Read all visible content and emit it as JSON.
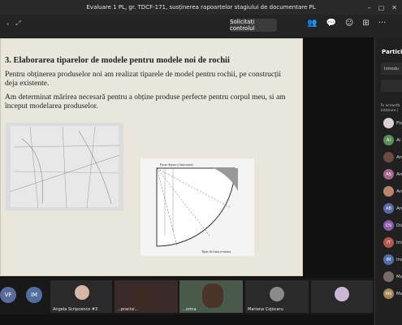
{
  "title": "Evaluare 1 PL, gr. TDCF-171, susținerea rapoartelor stagiului de documentare PL",
  "toolbar": {
    "request_control": "Solicitați controlul"
  },
  "slide": {
    "heading": "3. Elaborarea tiparelor de modele pentru modele noi de rochii",
    "p1": "Pentru obținerea produselor noi am realizat tiparele de model pentru rochii, pe construcții deja existente.",
    "p2": "Am determinat mărirea necesară pentru a obține produse perfecte pentru corpul meu, si am început modelarea produselor.",
    "figure_top_label": "Fusta dejuno (clasicaosa)",
    "figure_bottom_label": "Tipar de fusta evaziata"
  },
  "gallery": {
    "avatar1": "VF",
    "avatar2": "IM",
    "tile1_name": "Angela Scripcenco #3",
    "tile2_name": "...pracivi...",
    "tile3_name": "...orina",
    "tile4_name": "Mariana Cojocaru"
  },
  "panel": {
    "title": "Particip",
    "field": "Introdu",
    "section": "În această\nîntâlnire (",
    "participants": [
      {
        "initials": "",
        "name": "Flo",
        "color": "#d9cfd5"
      },
      {
        "initials": "AI",
        "name": "Ai",
        "color": "#5a8f5a"
      },
      {
        "initials": "",
        "name": "An",
        "color": "#6b4a3f"
      },
      {
        "initials": "AS",
        "name": "An",
        "color": "#a5648a"
      },
      {
        "initials": "",
        "name": "An",
        "color": "#b8866d"
      },
      {
        "initials": "AB",
        "name": "An",
        "color": "#5a6aa8"
      },
      {
        "initials": "DS",
        "name": "Dia",
        "color": "#8a5aa8"
      },
      {
        "initials": "IT",
        "name": "Irin",
        "color": "#b5554f"
      },
      {
        "initials": "IM",
        "name": "Iro",
        "color": "#4f6fa8"
      },
      {
        "initials": "",
        "name": "Ma",
        "color": "#7a6a6a"
      },
      {
        "initials": "MS",
        "name": "Ma",
        "color": "#a8845a"
      }
    ]
  }
}
